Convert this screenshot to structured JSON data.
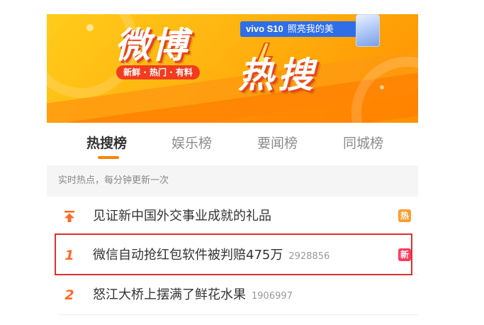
{
  "banner": {
    "title_part1": "微博",
    "title_part2": "热搜",
    "tagline": "新鲜 · 热门 · 有料",
    "ad_brand": "vivo S10",
    "ad_slogan": "照亮我的美"
  },
  "tabs": [
    {
      "label": "热搜榜",
      "active": true
    },
    {
      "label": "娱乐榜",
      "active": false
    },
    {
      "label": "要闻榜",
      "active": false
    },
    {
      "label": "同城榜",
      "active": false
    }
  ],
  "subheader": "实时热点，每分钟更新一次",
  "items": [
    {
      "rank": "pin",
      "title": "见证新中国外交事业成就的礼品",
      "count": "",
      "badge": "热",
      "badge_color": "#ff9b2f"
    },
    {
      "rank": "1",
      "title": "微信自动抢红包软件被判赔475万",
      "count": "2928856",
      "badge": "新",
      "badge_color": "#ff3b61"
    },
    {
      "rank": "2",
      "title": "怒江大桥上摆满了鲜花水果",
      "count": "1906997",
      "badge": "",
      "badge_color": ""
    }
  ],
  "colors": {
    "accent": "#ff8200",
    "rank": "#ff6a26",
    "highlight": "#e02f2f"
  }
}
